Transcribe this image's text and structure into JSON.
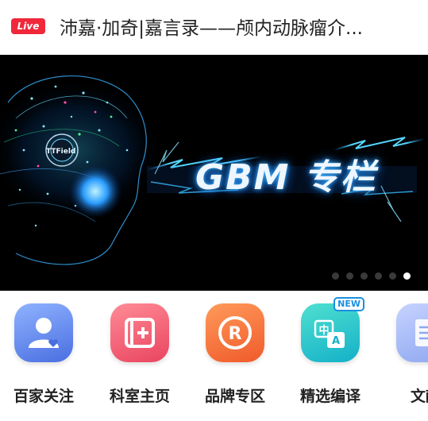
{
  "live": {
    "badge": "Live",
    "title": "沛嘉·加奇|嘉言录——颅内动脉瘤介..."
  },
  "banner": {
    "text": "GBM 专栏",
    "logo_text": "TTField",
    "dots_count": 6,
    "active_dot": 5
  },
  "shortcuts": [
    {
      "label": "百家关注",
      "icon": "person-heart-icon",
      "color": "#5b83e6"
    },
    {
      "label": "科室主页",
      "icon": "plus-card-icon",
      "color": "#ef5c6e"
    },
    {
      "label": "品牌专区",
      "icon": "registered-icon",
      "color": "#f26a3f"
    },
    {
      "label": "精选编译",
      "icon": "translate-icon",
      "color": "#1fc4b7",
      "badge": "NEW"
    },
    {
      "label": "文献",
      "icon": "document-icon",
      "color": "#8ea7f0"
    }
  ]
}
